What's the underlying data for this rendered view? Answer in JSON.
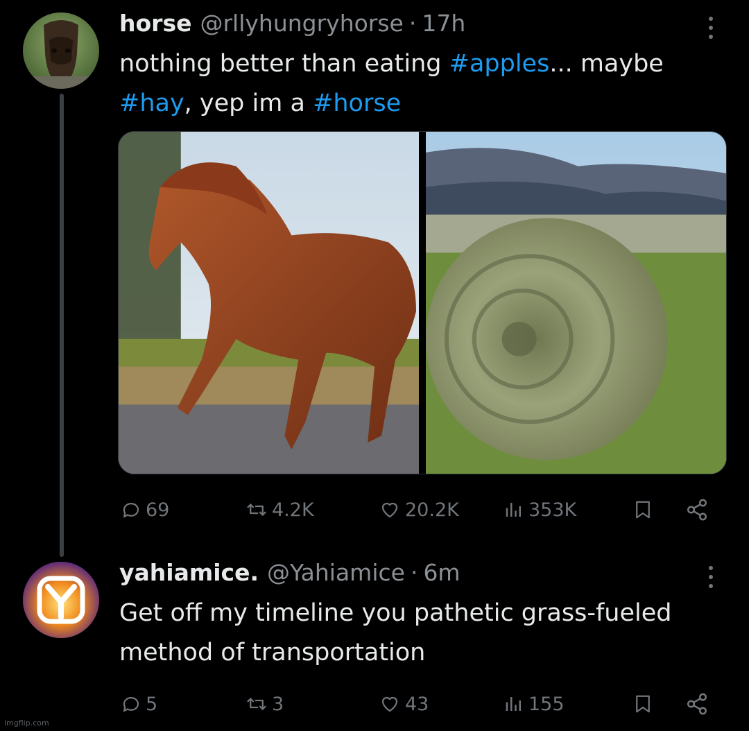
{
  "tweets": [
    {
      "display_name": "horse",
      "handle": "@rllyhungryhorse",
      "separator": "·",
      "time": "17h",
      "text_parts": [
        {
          "text": "nothing better than eating ",
          "tag": false
        },
        {
          "text": "#apples",
          "tag": true
        },
        {
          "text": "... maybe ",
          "tag": false
        },
        {
          "text": "#hay",
          "tag": true
        },
        {
          "text": ", yep im a ",
          "tag": false
        },
        {
          "text": "#horse",
          "tag": true
        }
      ],
      "media": [
        "photo of a chestnut horse galloping",
        "photo of a round hay bale in a field"
      ],
      "actions": {
        "replies": "69",
        "reposts": "4.2K",
        "likes": "20.2K",
        "views": "353K"
      }
    },
    {
      "display_name": "yahiamice.",
      "handle": "@Yahiamice",
      "separator": "·",
      "time": "6m",
      "text": "Get off my timeline you pathetic grass-fueled method of transportation",
      "actions": {
        "replies": "5",
        "reposts": "3",
        "likes": "43",
        "views": "155"
      }
    }
  ],
  "icons": [
    "more-icon",
    "reply-icon",
    "repost-icon",
    "like-icon",
    "views-icon",
    "bookmark-icon",
    "share-icon"
  ],
  "colors": {
    "background": "#000000",
    "text": "#e7e9ea",
    "muted": "#71767b",
    "hashtag": "#1d9bf0"
  },
  "watermark": "imgflip.com"
}
